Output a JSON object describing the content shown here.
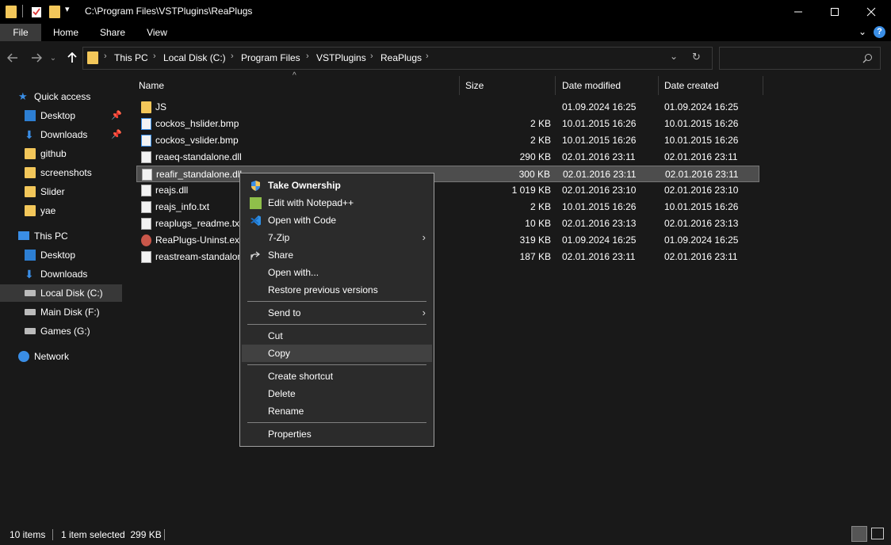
{
  "window": {
    "title": "C:\\Program Files\\VSTPlugins\\ReaPlugs",
    "controls": [
      "minimize-icon",
      "maximize-icon",
      "close-icon"
    ]
  },
  "ribbon": {
    "tabs": [
      "File",
      "Home",
      "Share",
      "View"
    ]
  },
  "address": {
    "breadcrumbs": [
      "This PC",
      "Local Disk (C:)",
      "Program Files",
      "VSTPlugins",
      "ReaPlugs"
    ],
    "search_placeholder": ""
  },
  "nav": {
    "items": [
      {
        "label": "Quick access",
        "icon": "star-icon"
      },
      {
        "label": "Desktop",
        "icon": "desktop-icon",
        "pinned": true
      },
      {
        "label": "Downloads",
        "icon": "download-icon",
        "pinned": true
      },
      {
        "label": "github",
        "icon": "folder-icon"
      },
      {
        "label": "screenshots",
        "icon": "folder-icon"
      },
      {
        "label": "Slider",
        "icon": "folder-icon"
      },
      {
        "label": "yae",
        "icon": "folder-icon"
      },
      {
        "label": "This PC",
        "icon": "computer-icon"
      },
      {
        "label": "Desktop",
        "icon": "desktop-icon"
      },
      {
        "label": "Downloads",
        "icon": "download-icon"
      },
      {
        "label": "Local Disk (C:)",
        "icon": "drive-icon",
        "selected": true
      },
      {
        "label": "Main Disk (F:)",
        "icon": "drive-icon"
      },
      {
        "label": "Games (G:)",
        "icon": "drive-icon"
      },
      {
        "label": "Network",
        "icon": "network-icon"
      }
    ]
  },
  "files": {
    "columns": [
      "Name",
      "Size",
      "Date modified",
      "Date created"
    ],
    "rows": [
      {
        "name": "JS",
        "size": "",
        "modified": "01.09.2024 16:25",
        "created": "01.09.2024 16:25",
        "type": "folder"
      },
      {
        "name": "cockos_hslider.bmp",
        "size": "2 KB",
        "modified": "10.01.2015 16:26",
        "created": "10.01.2015 16:26",
        "type": "bmp"
      },
      {
        "name": "cockos_vslider.bmp",
        "size": "2 KB",
        "modified": "10.01.2015 16:26",
        "created": "10.01.2015 16:26",
        "type": "bmp"
      },
      {
        "name": "reaeq-standalone.dll",
        "size": "290 KB",
        "modified": "02.01.2016 23:11",
        "created": "02.01.2016 23:11",
        "type": "dll"
      },
      {
        "name": "reafir_standalone.dll",
        "size": "300 KB",
        "modified": "02.01.2016 23:11",
        "created": "02.01.2016 23:11",
        "type": "dll",
        "selected": true
      },
      {
        "name": "reajs.dll",
        "size": "1 019 KB",
        "modified": "02.01.2016 23:10",
        "created": "02.01.2016 23:10",
        "type": "dll"
      },
      {
        "name": "reajs_info.txt",
        "size": "2 KB",
        "modified": "10.01.2015 16:26",
        "created": "10.01.2015 16:26",
        "type": "txt"
      },
      {
        "name": "reaplugs_readme.txt",
        "size": "10 KB",
        "modified": "02.01.2016 23:13",
        "created": "02.01.2016 23:13",
        "type": "txt"
      },
      {
        "name": "ReaPlugs-Uninst.exe",
        "size": "319 KB",
        "modified": "01.09.2024 16:25",
        "created": "01.09.2024 16:25",
        "type": "exe"
      },
      {
        "name": "reastream-standalone.dll",
        "size": "187 KB",
        "modified": "02.01.2016 23:11",
        "created": "02.01.2016 23:11",
        "type": "dll"
      }
    ]
  },
  "context_menu": {
    "items": [
      {
        "label": "Take Ownership",
        "icon": "shield-icon",
        "bold": true
      },
      {
        "label": "Edit with Notepad++",
        "icon": "notepad-icon"
      },
      {
        "label": "Open with Code",
        "icon": "vscode-icon"
      },
      {
        "label": "7-Zip",
        "submenu": true
      },
      {
        "label": "Share",
        "icon": "share-icon"
      },
      {
        "label": "Open with..."
      },
      {
        "label": "Restore previous versions"
      },
      {
        "label": "Send to",
        "submenu": true
      },
      {
        "label": "Cut"
      },
      {
        "label": "Copy",
        "highlighted": true
      },
      {
        "label": "Create shortcut"
      },
      {
        "label": "Delete"
      },
      {
        "label": "Rename"
      },
      {
        "label": "Properties"
      }
    ]
  },
  "status": {
    "count": "10 items",
    "selection": "1 item selected  299 KB"
  },
  "colors": {
    "background": "#191919",
    "titlebar": "#000000",
    "selected_row": "#4d4d4d",
    "menu_bg": "#2b2b2b",
    "folder": "#f3c75a",
    "accent_blue": "#3a8ee6"
  }
}
